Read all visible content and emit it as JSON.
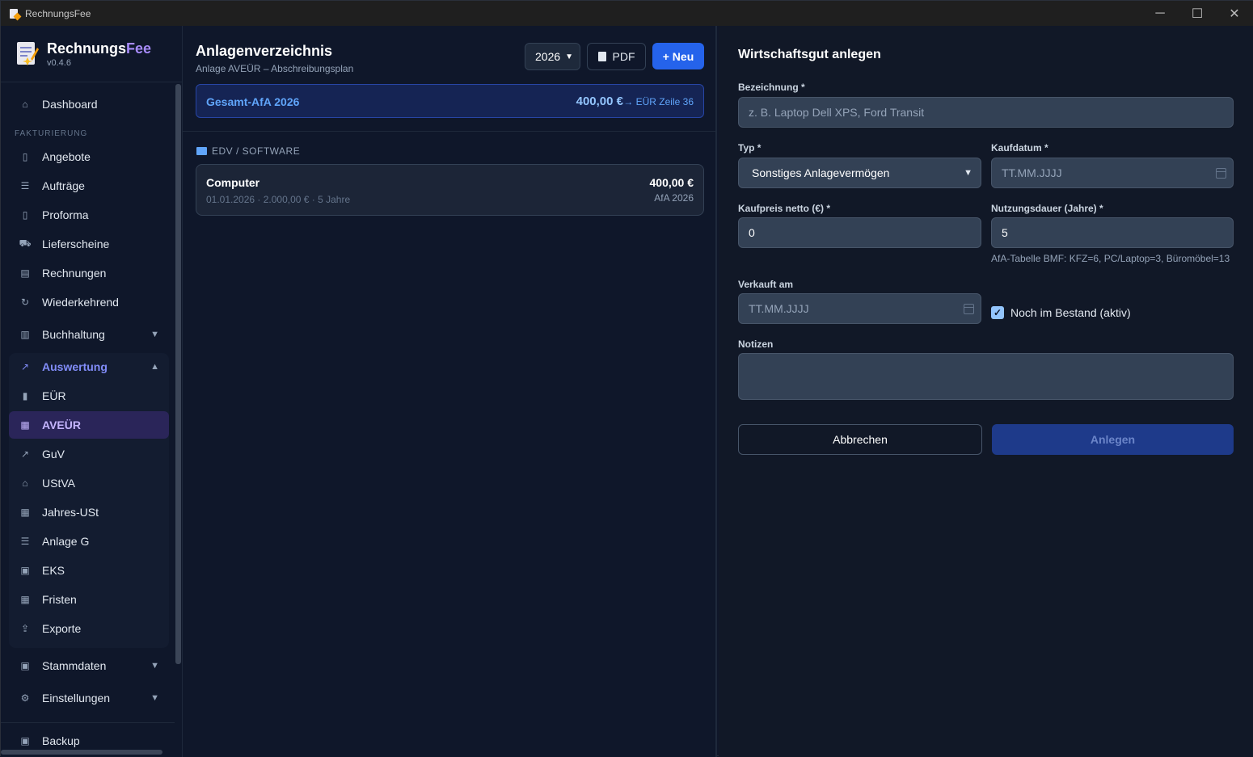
{
  "window": {
    "title": "RechnungsFee",
    "min_icon": "minimize-icon",
    "max_icon": "maximize-icon",
    "close_icon": "close-icon"
  },
  "brand": {
    "name_main": "Rechnungs",
    "name_accent": "Fee",
    "version": "v0.4.6",
    "accent_color": "#a78bfa"
  },
  "sidebar": {
    "dashboard": "Dashboard",
    "section_fakturierung": "FAKTURIERUNG",
    "angebote": "Angebote",
    "auftraege": "Aufträge",
    "proforma": "Proforma",
    "lieferscheine": "Lieferscheine",
    "rechnungen": "Rechnungen",
    "wiederkehrend": "Wiederkehrend",
    "buchhaltung": "Buchhaltung",
    "auswertung": "Auswertung",
    "eur": "EÜR",
    "aveur": "AVEÜR",
    "guv": "GuV",
    "ustva": "UStVA",
    "jahres_ust": "Jahres-USt",
    "anlage_g": "Anlage G",
    "eks": "EKS",
    "fristen": "Fristen",
    "exporte": "Exporte",
    "stammdaten": "Stammdaten",
    "einstellungen": "Einstellungen",
    "backup": "Backup"
  },
  "middle": {
    "title": "Anlagenverzeichnis",
    "subtitle": "Anlage AVEÜR – Abschreibungsplan",
    "year": "2026",
    "pdf_label": "PDF",
    "new_label": "+ Neu",
    "afa_label": "Gesamt-AfA 2026",
    "afa_value": "400,00 €",
    "afa_ref": "→ EÜR Zeile 36",
    "category": "EDV / SOFTWARE",
    "asset": {
      "name": "Computer",
      "meta": "01.01.2026 · 2.000,00 € · 5 Jahre",
      "amount": "400,00 €",
      "afa": "AfA 2026"
    }
  },
  "form": {
    "title": "Wirtschaftsgut anlegen",
    "bezeichnung_label": "Bezeichnung *",
    "bezeichnung_placeholder": "z. B. Laptop Dell XPS, Ford Transit",
    "typ_label": "Typ *",
    "typ_value": "Sonstiges Anlagevermögen",
    "kaufdatum_label": "Kaufdatum *",
    "kaufdatum_placeholder": "TT.MM.JJJJ",
    "kaufpreis_label": "Kaufpreis netto (€) *",
    "kaufpreis_value": "0",
    "nutzungsdauer_label": "Nutzungsdauer (Jahre) *",
    "nutzungsdauer_value": "5",
    "afa_hint": "AfA-Tabelle BMF: KFZ=6, PC/Laptop=3, Büromöbel=13",
    "verkauft_label": "Verkauft am",
    "verkauft_placeholder": "TT.MM.JJJJ",
    "bestand_label": "Noch im Bestand (aktiv)",
    "bestand_checked": true,
    "notizen_label": "Notizen",
    "notizen_value": "",
    "cancel_label": "Abbrechen",
    "create_label": "Anlegen"
  }
}
